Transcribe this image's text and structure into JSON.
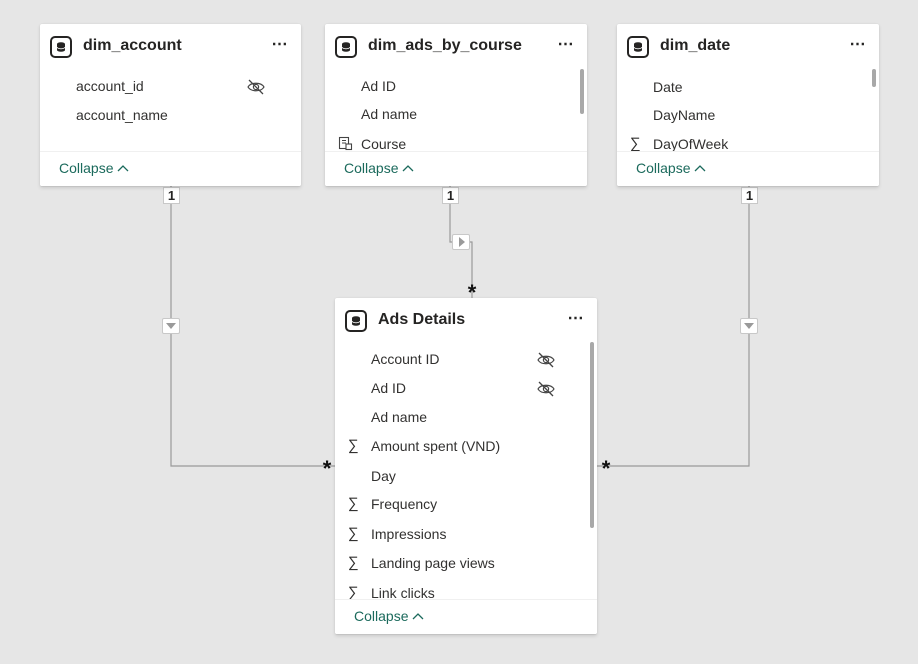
{
  "tables": {
    "dim_account": {
      "title": "dim_account",
      "fields": [
        {
          "name": "account_id",
          "icon": "",
          "hidden": true
        },
        {
          "name": "account_name",
          "icon": "",
          "hidden": false
        }
      ],
      "collapse_label": "Collapse"
    },
    "dim_ads_by_course": {
      "title": "dim_ads_by_course",
      "fields": [
        {
          "name": "Ad ID",
          "icon": "",
          "hidden": false
        },
        {
          "name": "Ad name",
          "icon": "",
          "hidden": false
        },
        {
          "name": "Course",
          "icon": "hierarchy-icon",
          "hidden": false
        }
      ],
      "collapse_label": "Collapse"
    },
    "dim_date": {
      "title": "dim_date",
      "fields": [
        {
          "name": "Date",
          "icon": "",
          "hidden": false
        },
        {
          "name": "DayName",
          "icon": "",
          "hidden": false
        },
        {
          "name": "DayOfWeek",
          "icon": "sigma-icon",
          "hidden": false
        }
      ],
      "collapse_label": "Collapse"
    },
    "ads_details": {
      "title": "Ads Details",
      "fields": [
        {
          "name": "Account ID",
          "icon": "",
          "hidden": true
        },
        {
          "name": "Ad ID",
          "icon": "",
          "hidden": true
        },
        {
          "name": "Ad name",
          "icon": "",
          "hidden": false
        },
        {
          "name": "Amount spent (VND)",
          "icon": "sigma-icon",
          "hidden": false
        },
        {
          "name": "Day",
          "icon": "",
          "hidden": false
        },
        {
          "name": "Frequency",
          "icon": "sigma-icon",
          "hidden": false
        },
        {
          "name": "Impressions",
          "icon": "sigma-icon",
          "hidden": false
        },
        {
          "name": "Landing page views",
          "icon": "sigma-icon",
          "hidden": false
        },
        {
          "name": "Link clicks",
          "icon": "sigma-icon",
          "hidden": false
        }
      ],
      "collapse_label": "Collapse"
    }
  },
  "relationships": {
    "one_label": "1",
    "many_label": "*"
  },
  "icons": {
    "more": "⋯",
    "sigma": "∑",
    "chevron_up": "chevron-up-icon",
    "database": "database-icon",
    "hidden": "eye-hidden-icon"
  },
  "colors": {
    "canvas": "#e6e6e6",
    "collapse_text": "#1b6a5c",
    "line": "#999999"
  }
}
